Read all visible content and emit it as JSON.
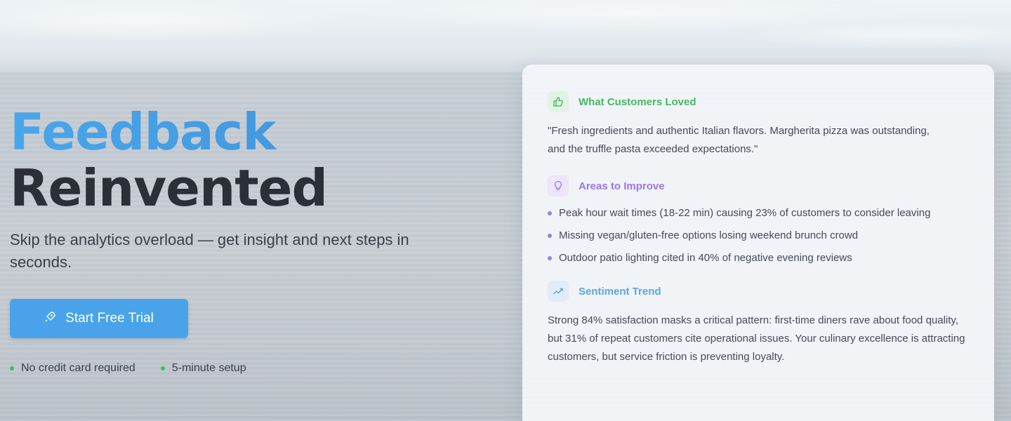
{
  "hero": {
    "title_line1": "Feedback",
    "title_line2": "Reinvented",
    "subtitle": "Skip the analytics overload — get insight and next steps in seconds.",
    "cta_label": "Start Free Trial",
    "cta_icon": "rocket-icon",
    "trust_items": [
      "No credit card required",
      "5-minute setup"
    ]
  },
  "card": {
    "loved": {
      "heading": "What Customers Loved",
      "icon": "thumbs-up-icon",
      "quote": "\"Fresh ingredients and authentic Italian flavors. Margherita pizza was outstanding, and the truffle pasta exceeded expectations.\""
    },
    "improve": {
      "heading": "Areas to Improve",
      "icon": "lightbulb-icon",
      "items": [
        "Peak hour wait times (18-22 min) causing 23% of customers to consider leaving",
        "Missing vegan/gluten-free options losing weekend brunch crowd",
        "Outdoor patio lighting cited in 40% of negative evening reviews"
      ]
    },
    "trend": {
      "heading": "Sentiment Trend",
      "icon": "trend-chart-icon",
      "text": "Strong 84% satisfaction masks a critical pattern: first-time diners rave about food quality, but 31% of repeat customers cite operational issues. Your culinary excellence is attracting customers, but service friction is preventing loyalty."
    }
  },
  "colors": {
    "accent_blue": "#4aa3ea",
    "title_dark": "#2b2f38",
    "green": "#3dbb5b",
    "purple": "#9a78e6"
  }
}
